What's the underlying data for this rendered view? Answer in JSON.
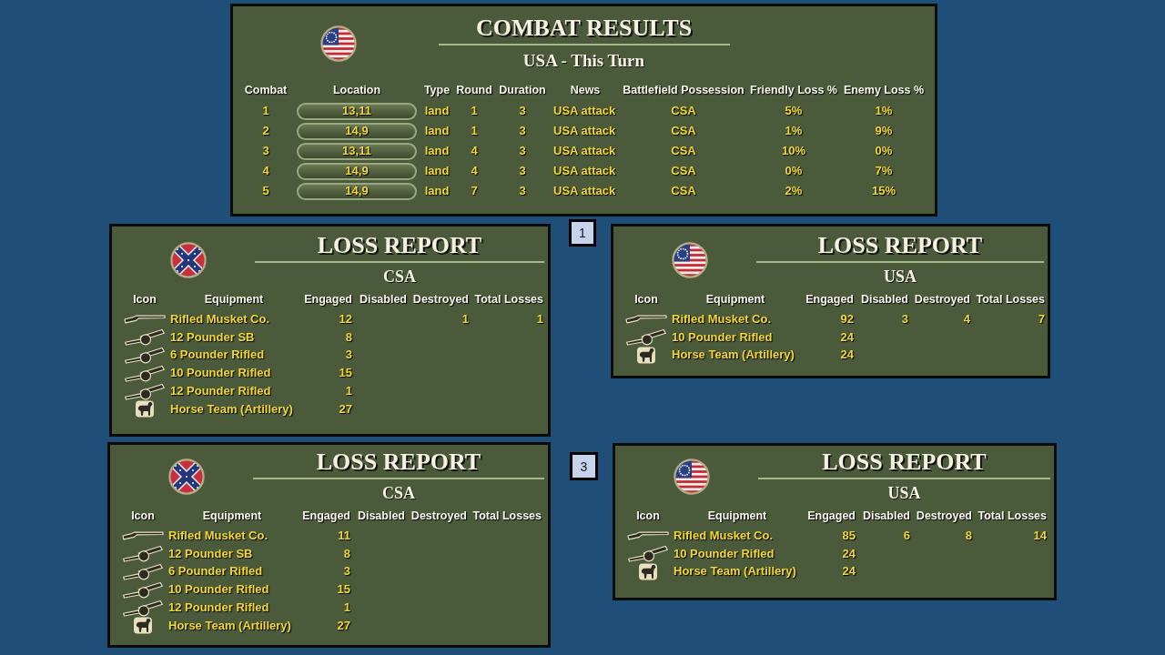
{
  "combat_results": {
    "flag": {
      "kind": "stripes"
    },
    "title": "COMBAT RESULTS",
    "subtitle": "USA - This Turn",
    "columns": [
      "Combat",
      "Location",
      "Type",
      "Round",
      "Duration",
      "News",
      "Battlefield Possession",
      "Friendly Loss %",
      "Enemy Loss %"
    ],
    "rows": [
      {
        "combat": "1",
        "location": "13,11",
        "combat_type": "land",
        "round": "1",
        "duration": "3",
        "news": "USA attack",
        "possession": "CSA",
        "friendly_loss": "5%",
        "enemy_loss": "1%"
      },
      {
        "combat": "2",
        "location": "14,9",
        "combat_type": "land",
        "round": "1",
        "duration": "3",
        "news": "USA attack",
        "possession": "CSA",
        "friendly_loss": "1%",
        "enemy_loss": "9%"
      },
      {
        "combat": "3",
        "location": "13,11",
        "combat_type": "land",
        "round": "4",
        "duration": "3",
        "news": "USA attack",
        "possession": "CSA",
        "friendly_loss": "10%",
        "enemy_loss": "0%"
      },
      {
        "combat": "4",
        "location": "14,9",
        "combat_type": "land",
        "round": "4",
        "duration": "3",
        "news": "USA attack",
        "possession": "CSA",
        "friendly_loss": "0%",
        "enemy_loss": "7%"
      },
      {
        "combat": "5",
        "location": "14,9",
        "combat_type": "land",
        "round": "7",
        "duration": "3",
        "news": "USA attack",
        "possession": "CSA",
        "friendly_loss": "2%",
        "enemy_loss": "15%"
      }
    ]
  },
  "loss_reports": [
    {
      "flag": {
        "kind": "saltire"
      },
      "title": "LOSS REPORT",
      "subtitle": "CSA",
      "columns": [
        "Icon",
        "Equipment",
        "Engaged",
        "Disabled",
        "Destroyed",
        "Total Losses"
      ],
      "rows": [
        {
          "kind": "musket",
          "equipment": "Rifled Musket Co.",
          "engaged": "12",
          "destroyed": "1",
          "total_losses": "1"
        },
        {
          "kind": "cannon",
          "equipment": "12 Pounder SB",
          "engaged": "8"
        },
        {
          "kind": "cannon",
          "equipment": "6 Pounder Rifled",
          "engaged": "3"
        },
        {
          "kind": "cannon",
          "equipment": "10 Pounder Rifled",
          "engaged": "15"
        },
        {
          "kind": "cannon",
          "equipment": "12 Pounder Rifled",
          "engaged": "1"
        },
        {
          "kind": "horse",
          "equipment": "Horse Team (Artillery)",
          "engaged": "27"
        }
      ]
    },
    {
      "flag": {
        "kind": "stripes"
      },
      "title": "LOSS REPORT",
      "subtitle": "USA",
      "columns": [
        "Icon",
        "Equipment",
        "Engaged",
        "Disabled",
        "Destroyed",
        "Total Losses"
      ],
      "rows": [
        {
          "kind": "musket",
          "equipment": "Rifled Musket Co.",
          "engaged": "92",
          "disabled": "3",
          "destroyed": "4",
          "total_losses": "7"
        },
        {
          "kind": "cannon",
          "equipment": "10 Pounder Rifled",
          "engaged": "24"
        },
        {
          "kind": "horse",
          "equipment": "Horse Team (Artillery)",
          "engaged": "24"
        }
      ]
    },
    {
      "flag": {
        "kind": "saltire"
      },
      "title": "LOSS REPORT",
      "subtitle": "CSA",
      "columns": [
        "Icon",
        "Equipment",
        "Engaged",
        "Disabled",
        "Destroyed",
        "Total Losses"
      ],
      "rows": [
        {
          "kind": "musket",
          "equipment": "Rifled Musket Co.",
          "engaged": "11"
        },
        {
          "kind": "cannon",
          "equipment": "12 Pounder SB",
          "engaged": "8"
        },
        {
          "kind": "cannon",
          "equipment": "6 Pounder Rifled",
          "engaged": "3"
        },
        {
          "kind": "cannon",
          "equipment": "10 Pounder Rifled",
          "engaged": "15"
        },
        {
          "kind": "cannon",
          "equipment": "12 Pounder Rifled",
          "engaged": "1"
        },
        {
          "kind": "horse",
          "equipment": "Horse Team (Artillery)",
          "engaged": "27"
        }
      ]
    },
    {
      "flag": {
        "kind": "stripes"
      },
      "title": "LOSS REPORT",
      "subtitle": "USA",
      "columns": [
        "Icon",
        "Equipment",
        "Engaged",
        "Disabled",
        "Destroyed",
        "Total Losses"
      ],
      "rows": [
        {
          "kind": "musket",
          "equipment": "Rifled Musket Co.",
          "engaged": "85",
          "disabled": "6",
          "destroyed": "8",
          "total_losses": "14"
        },
        {
          "kind": "cannon",
          "equipment": "10 Pounder Rifled",
          "engaged": "24"
        },
        {
          "kind": "horse",
          "equipment": "Horse Team (Artillery)",
          "engaged": "24"
        }
      ]
    }
  ],
  "markers": [
    "1",
    "3"
  ]
}
